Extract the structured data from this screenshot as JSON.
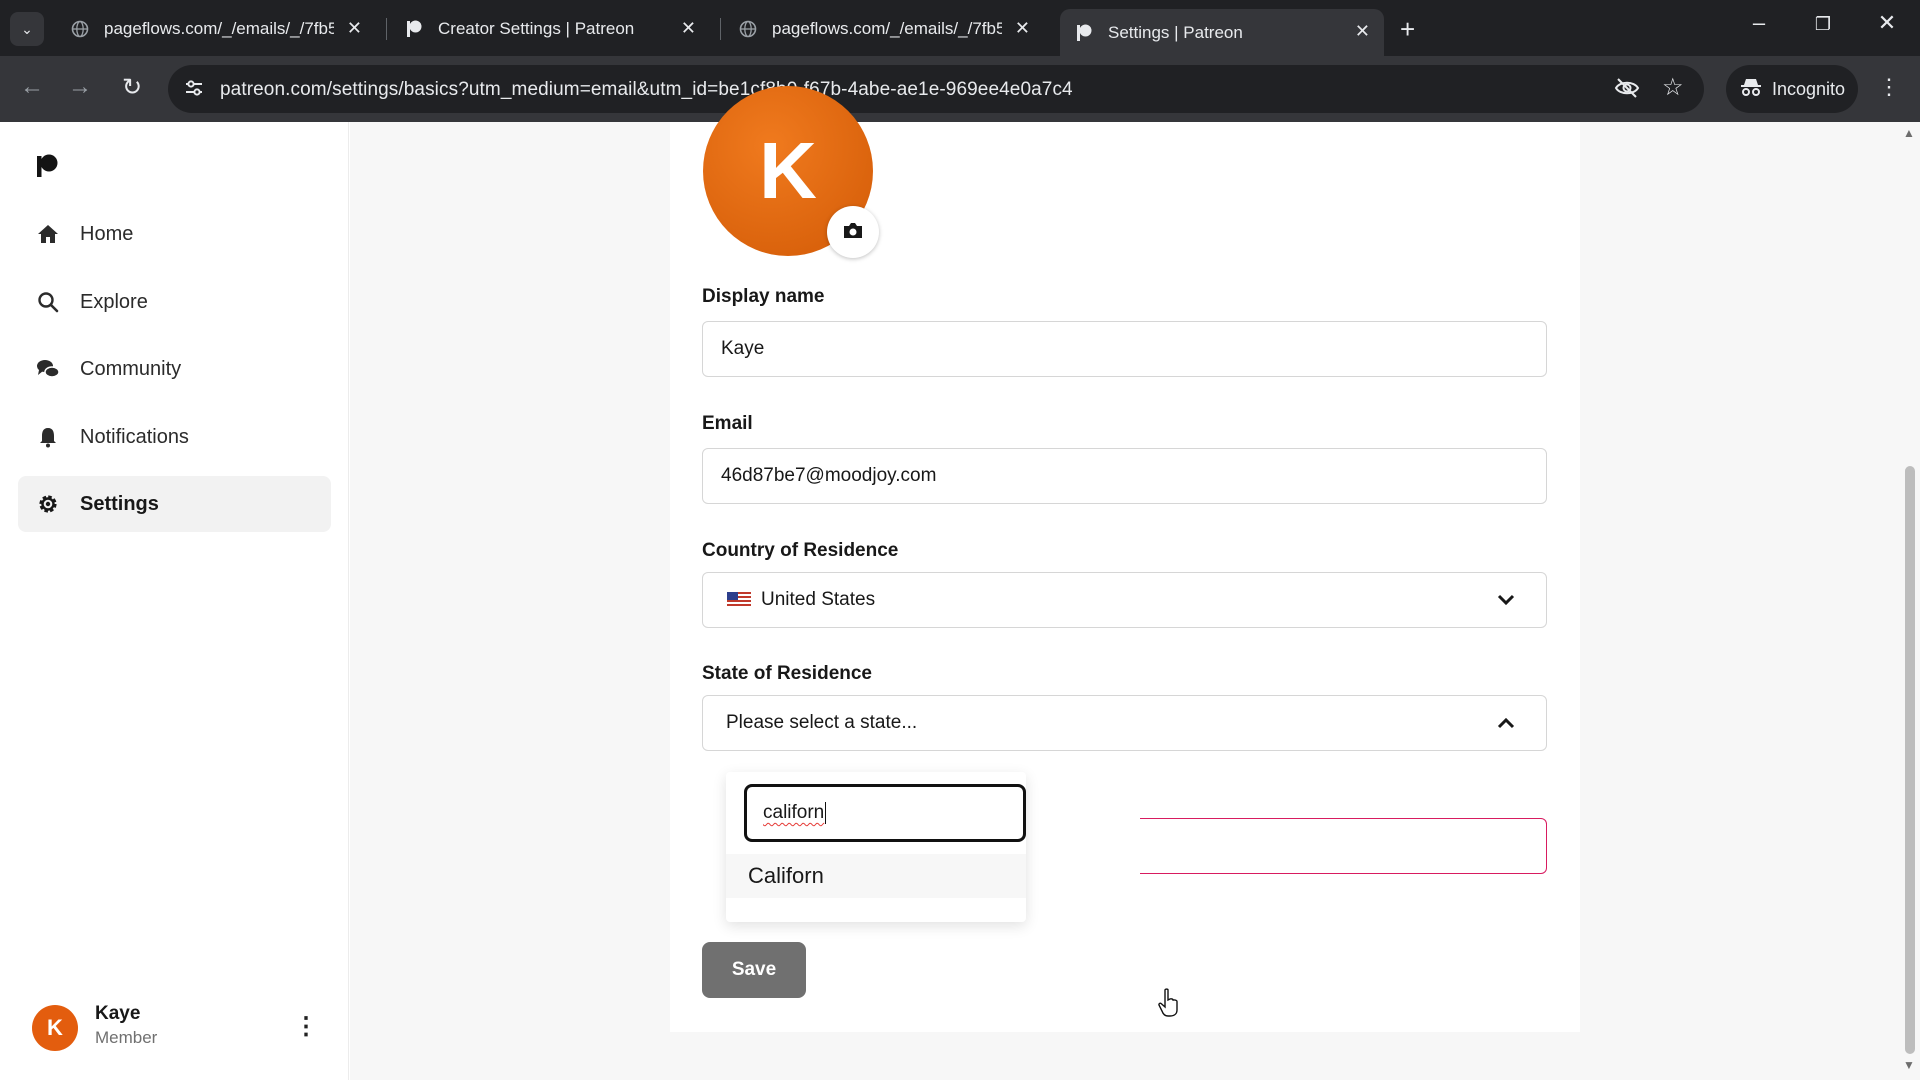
{
  "browser": {
    "tabs": [
      {
        "title": "pageflows.com/_/emails/_/7fb5",
        "active": false,
        "favicon": "globe-icon"
      },
      {
        "title": "Creator Settings | Patreon",
        "active": false,
        "favicon": "patreon-icon"
      },
      {
        "title": "pageflows.com/_/emails/_/7fb5",
        "active": false,
        "favicon": "globe-icon"
      },
      {
        "title": "Settings | Patreon",
        "active": true,
        "favicon": "patreon-icon"
      }
    ],
    "url": "patreon.com/settings/basics?utm_medium=email&utm_id=be1cf8b0-f67b-4abe-ae1e-969ee4e0a7c4",
    "incognito_label": "Incognito"
  },
  "sidebar": {
    "items": [
      {
        "label": "Home",
        "icon": "home-icon",
        "active": false
      },
      {
        "label": "Explore",
        "icon": "search-icon",
        "active": false
      },
      {
        "label": "Community",
        "icon": "chat-bubbles-icon",
        "active": false
      },
      {
        "label": "Notifications",
        "icon": "bell-icon",
        "active": false
      },
      {
        "label": "Settings",
        "icon": "gear-icon",
        "active": true
      }
    ],
    "user": {
      "initial": "K",
      "name": "Kaye",
      "role": "Member"
    }
  },
  "profile": {
    "avatar_initial": "K",
    "display_name_label": "Display name",
    "display_name_value": "Kaye",
    "email_label": "Email",
    "email_value": "46d87be7@moodjoy.com",
    "country_label": "Country of Residence",
    "country_value": "United States",
    "state_label": "State of Residence",
    "state_placeholder": "Please select a state...",
    "state_search_value": "californ",
    "state_option": "Californ",
    "save_label": "Save"
  },
  "colors": {
    "accent": "#e35d0e",
    "error_border": "#d81b60",
    "save_button": "#707070"
  }
}
